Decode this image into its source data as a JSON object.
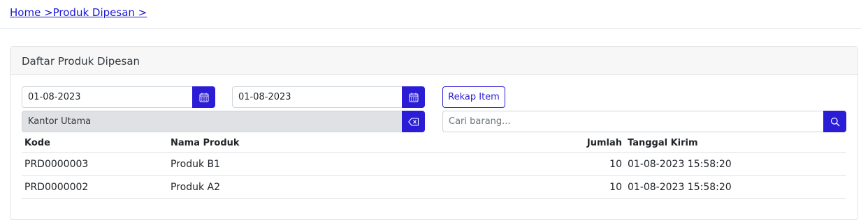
{
  "breadcrumb": {
    "home": "Home >",
    "current": "Produk Dipesan >"
  },
  "card": {
    "title": "Daftar Produk Dipesan"
  },
  "filters": {
    "date_from": "01-08-2023",
    "date_to": "01-08-2023",
    "branch": "Kantor Utama",
    "search_placeholder": "Cari barang...",
    "search_value": "",
    "rekap_label": "Rekap Item"
  },
  "icons": {
    "calendar": "calendar-icon",
    "clear": "backspace-icon",
    "search": "search-icon"
  },
  "colors": {
    "primary": "#2b1dd6",
    "link": "#1a1ad6",
    "readonly_bg": "#dfe1e4",
    "header_bg": "#f7f7f7"
  },
  "table": {
    "headers": [
      "Kode",
      "Nama Produk",
      "Jumlah",
      "Tanggal Kirim"
    ],
    "rows": [
      [
        "PRD0000003",
        "Produk B1",
        "10",
        "01-08-2023 15:58:20"
      ],
      [
        "PRD0000002",
        "Produk A2",
        "10",
        "01-08-2023 15:58:20"
      ]
    ]
  }
}
